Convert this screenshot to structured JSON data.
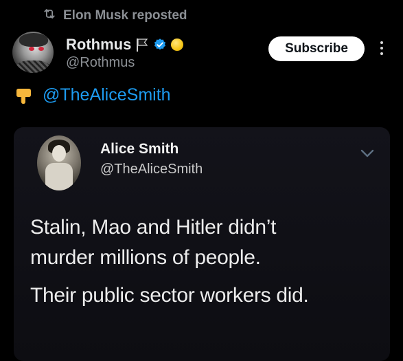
{
  "repost": {
    "label": "Elon Musk reposted",
    "icon": "repost-icon"
  },
  "author": {
    "display_name": "Rothmus",
    "handle": "@Rothmus",
    "badges": [
      "flag-icon",
      "verified-icon",
      "coin-icon"
    ],
    "verified_color": "#1d9bf0"
  },
  "actions": {
    "subscribe_label": "Subscribe",
    "more_icon": "more-options-icon"
  },
  "post": {
    "emoji_icon": "pointing-down-hand-icon",
    "mention": "@TheAliceSmith",
    "mention_color": "#1d9bf0"
  },
  "embedded": {
    "name": "Alice Smith",
    "handle": "@TheAliceSmith",
    "chevron_icon": "chevron-down-icon",
    "lines": [
      "Stalin, Mao and Hitler didn’t",
      "murder millions of people.",
      "Their public sector workers did."
    ]
  }
}
